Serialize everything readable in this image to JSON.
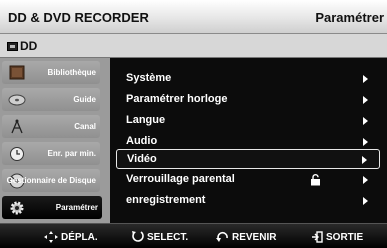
{
  "header": {
    "title": "DD & DVD RECORDER",
    "right_label": "Paramétrer"
  },
  "subheader": {
    "label": "DD"
  },
  "sidebar": {
    "items": [
      {
        "label": "Bibliothèque",
        "icon": "library-icon"
      },
      {
        "label": "Guide",
        "icon": "disc-icon"
      },
      {
        "label": "Canal",
        "icon": "antenna-icon"
      },
      {
        "label": "Enr. par min.",
        "icon": "timer-icon"
      },
      {
        "label": "Gestionnaire de Disque",
        "icon": "disc-manager-icon"
      },
      {
        "label": "Paramétrer",
        "icon": "settings-gear-icon",
        "active": true
      }
    ]
  },
  "menu": {
    "items": [
      {
        "label": "Système"
      },
      {
        "label": "Paramétrer horloge"
      },
      {
        "label": "Langue"
      },
      {
        "label": "Audio"
      },
      {
        "label": "Vidéo",
        "selected": true
      },
      {
        "label": "Verrouillage parental",
        "icon": "lock-icon"
      },
      {
        "label": "enregistrement"
      }
    ]
  },
  "footer": {
    "move": "DÉPLA.",
    "select": "SELECT.",
    "back": "REVENIR",
    "exit": "SORTIE"
  }
}
